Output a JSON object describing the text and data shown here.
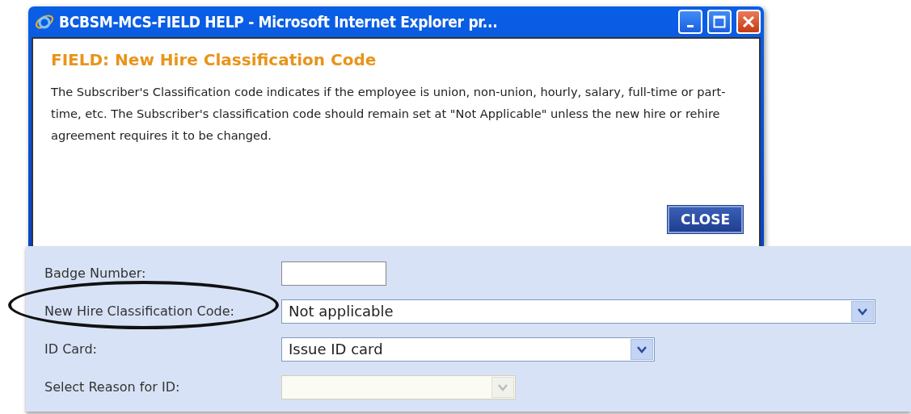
{
  "window": {
    "title": "BCBSM-MCS-FIELD HELP - Microsoft Internet Explorer pr..."
  },
  "help": {
    "heading": "FIELD: New Hire Classification Code",
    "body": "The Subscriber's Classification code indicates if the employee is union, non-union, hourly, salary, full-time or part-time, etc. The Subscriber's classification code should remain set at \"Not Applicable\" unless the new hire or rehire agreement requires it to be changed.",
    "close_button": "CLOSE"
  },
  "form": {
    "fields": [
      {
        "kind": "text",
        "label": "Badge Number:"
      },
      {
        "kind": "select",
        "label": "New Hire Classification Code:",
        "value": "Not applicable",
        "disabled": false,
        "circled": true
      },
      {
        "kind": "select",
        "label": "ID Card:",
        "value": "Issue ID card",
        "disabled": false,
        "circled": false
      },
      {
        "kind": "select",
        "label": "Select Reason for ID:",
        "disabled": true,
        "circled": false
      }
    ]
  }
}
